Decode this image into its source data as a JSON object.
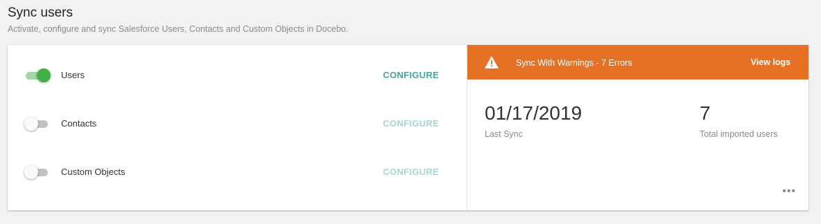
{
  "header": {
    "title": "Sync users",
    "subtitle": "Activate, configure and sync Salesforce Users, Contacts and Custom Objects in Docebo."
  },
  "sync_items": [
    {
      "label": "Users",
      "enabled": true,
      "configure_label": "CONFIGURE"
    },
    {
      "label": "Contacts",
      "enabled": false,
      "configure_label": "CONFIGURE"
    },
    {
      "label": "Custom Objects",
      "enabled": false,
      "configure_label": "CONFIGURE"
    }
  ],
  "status": {
    "banner_text": "Sync With Warnings - 7 Errors",
    "view_logs_label": "View logs",
    "banner_color": "#e57224",
    "banner_icon": "warning-icon"
  },
  "stats": {
    "last_sync_value": "01/17/2019",
    "last_sync_label": "Last Sync",
    "imported_value": "7",
    "imported_label": "Total imported users"
  },
  "more_menu": {
    "icon": "more-horizontal-icon",
    "glyph": "•••"
  },
  "colors": {
    "toggle_on": "#43b047",
    "configure_active": "#4aa3a3",
    "configure_disabled": "#a9d5d5"
  }
}
